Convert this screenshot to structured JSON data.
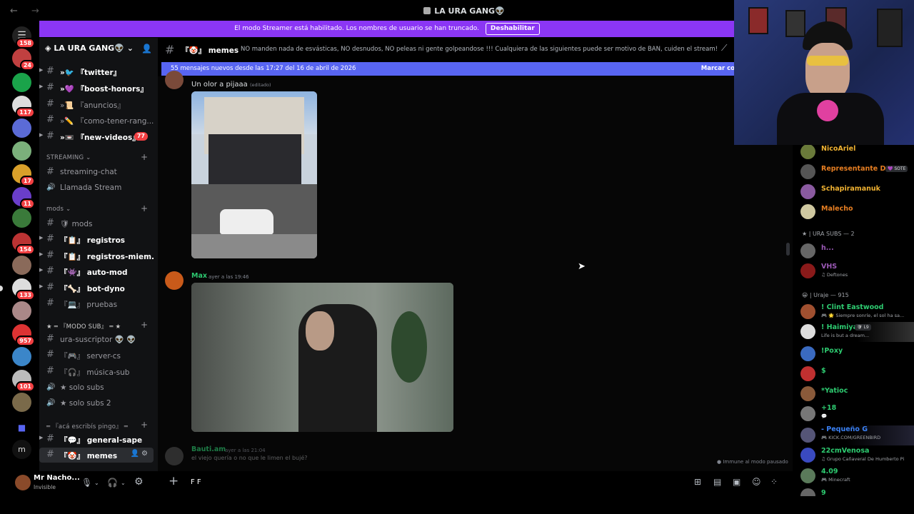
{
  "window": {
    "back": "←",
    "forward": "→",
    "title": "LA URA GANG👽"
  },
  "server_badges": [
    "158",
    "24",
    "",
    "117",
    "",
    "",
    "17",
    "11",
    "",
    "154",
    "",
    "133",
    "",
    "957",
    "",
    "101",
    ""
  ],
  "banner": {
    "text": "El modo Streamer está habilitado. Los nombres de usuario se han truncado.",
    "button": "Deshabilitar"
  },
  "guild": {
    "name": "LA URA GANG👽",
    "chevron": "⌄"
  },
  "channels": [
    {
      "name": "『twitter』",
      "prefix": "»🐦",
      "unread": true
    },
    {
      "name": "『boost-honors』",
      "prefix": "»💜",
      "unread": true
    },
    {
      "name": "『anuncios』",
      "prefix": "»📜",
      "unread": false
    },
    {
      "name": "『como-tener-rang...",
      "prefix": "»✏️",
      "unread": false
    },
    {
      "name": "『new-videos』",
      "prefix": "»📼",
      "unread": true,
      "badge": "77"
    }
  ],
  "cat_streaming": "STREAMING",
  "streaming": [
    {
      "icon": "#",
      "name": "streaming-chat"
    },
    {
      "icon": "🔊",
      "name": "Llamada Stream"
    }
  ],
  "cat_mods": "mods",
  "mods": [
    {
      "name": "🛡 mods",
      "unread": false
    },
    {
      "name": "『📋』 registros",
      "unread": true
    },
    {
      "name": "『📋』 registros-miem...",
      "unread": true
    },
    {
      "name": "『👾』 auto-mod",
      "unread": true
    },
    {
      "name": "『🦴』 bot-dyno",
      "unread": true
    },
    {
      "name": "『💻』 pruebas",
      "unread": false
    }
  ],
  "cat_sub": "★ ═ 『MODO SUB』 ═ ★",
  "sub": [
    {
      "icon": "#",
      "name": "ura-suscriptor 👽 👽"
    },
    {
      "icon": "#",
      "name": "『🎮』 server-cs"
    },
    {
      "icon": "#",
      "name": "『🎧』 música-sub"
    },
    {
      "icon": "🔊",
      "name": "★ solo subs"
    },
    {
      "icon": "🔊",
      "name": "★ solo subs 2"
    }
  ],
  "cat_acá": "═ 『acá escribís pingo』 ═",
  "acá": [
    {
      "name": "『💬』 general-sape",
      "unread": true
    },
    {
      "name": "『🤡』 memes",
      "active": true
    }
  ],
  "user": {
    "name": "Mr Nacho...",
    "status": "Invisible"
  },
  "header": {
    "channel": "『🤡』 memes",
    "topic": "NO manden nada de esvásticas, NO desnudos, NO peleas ni gente golpeandose !!! Cualquiera de las siguientes puede ser motivo de BAN, cuiden el stream!"
  },
  "new_messages": {
    "text": "55 mensajes nuevos desde las 17:27 del 16 de abril de 2026",
    "action": "Marcar co"
  },
  "messages": [
    {
      "text": "Un olor a pijaaa",
      "edited": "(editado)"
    },
    {
      "author": "Max",
      "time": "ayer a las 19:46",
      "color": "#2dc770"
    },
    {
      "author": "Bauti.am",
      "time": "ayer a las 21:04",
      "text": "el viejo quería o no que le limen el bujé?",
      "color": "#2dc770"
    }
  ],
  "paused": "Immune al modo pausado",
  "composer": {
    "text": "F F"
  },
  "members": {
    "top": [
      {
        "name": "NicoAriel",
        "color": "#f0b232"
      },
      {
        "name": "Representante D...",
        "color": "#e67e22",
        "tag": "💜 SOTE"
      },
      {
        "name": "Schapiramanuk",
        "color": "#f0b232"
      },
      {
        "name": "Malecho",
        "color": "#e67e22"
      }
    ],
    "hdr1": "★ | URA SUBS — 2",
    "subs": [
      {
        "name": "h...",
        "color": "#9b59b6"
      },
      {
        "name": "VHS",
        "color": "#9b59b6",
        "sub": "♫ Deftones"
      }
    ],
    "hdr2": "😀 | Uraje — 915",
    "uraje": [
      {
        "name": "! Clint Eastwood",
        "color": "#2ecc71",
        "sub": "🎮 🌟 Siempre sonríe, el sol ha sa..."
      },
      {
        "name": "! Haimiya",
        "color": "#2ecc71",
        "sub": "Life is but a dream...",
        "tag": "🛡 L9"
      },
      {
        "name": "!Poxy",
        "color": "#2ecc71"
      },
      {
        "name": "$",
        "color": "#2ecc71"
      },
      {
        "name": "*Yatioc",
        "color": "#2ecc71"
      },
      {
        "name": "+18",
        "color": "#2ecc71",
        "sub": "💬"
      },
      {
        "name": "- Pequeño G",
        "color": "#3b82f6",
        "sub": "🎮 KICK.COM/GREENBIRD"
      },
      {
        "name": "22cmVenosa",
        "color": "#2ecc71",
        "sub": "♫ Grupo Cañaveral De Humberto Pi"
      },
      {
        "name": "4.09",
        "color": "#2ecc71",
        "sub": "🎮 Minecraft"
      },
      {
        "name": "9",
        "color": "#2ecc71"
      }
    ]
  }
}
